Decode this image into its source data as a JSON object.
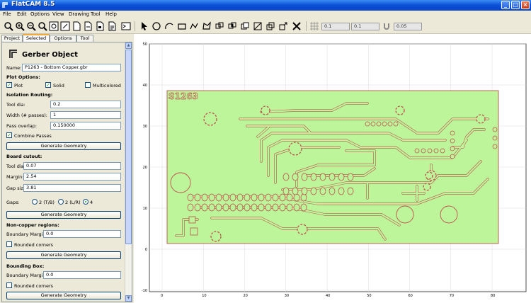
{
  "window": {
    "title": "FlatCAM 8.5",
    "controls": [
      "_",
      "□",
      "×"
    ]
  },
  "menubar": [
    "File",
    "Edit",
    "Options",
    "View",
    "Drawing",
    "Tool",
    "Help"
  ],
  "toolbar": {
    "icons": [
      "zoom-fit-icon",
      "zoom-in-icon",
      "zoom-out-icon",
      "redraw-icon",
      "clear-plot-icon",
      "new-icon",
      "open-gerber-icon",
      "open-excellon-icon",
      "open-gcode-icon",
      "shell-icon",
      "select-icon",
      "circle-icon",
      "arc-icon",
      "rectangle-icon",
      "path-icon",
      "polygon-icon",
      "union-icon",
      "intersection-icon",
      "subtract-icon",
      "cut-path-icon",
      "copy-icon",
      "move-icon",
      "delete-icon"
    ],
    "field1": "0.1",
    "field2": "0.1",
    "field3": "0.05"
  },
  "tabs": [
    {
      "label": "Project",
      "active": false
    },
    {
      "label": "Selected",
      "active": true
    },
    {
      "label": "Options",
      "active": false
    },
    {
      "label": "Tool",
      "active": false
    }
  ],
  "panel": {
    "title": "Gerber Object",
    "name_label": "Name:",
    "name_value": "P1263 - Bottom Copper.gbr",
    "plot_options": "Plot Options:",
    "plot": "Plot",
    "solid": "Solid",
    "multicolored": "Multicolored",
    "isolation": "Isolation Routing:",
    "tool_dia": "Tool dia:",
    "tool_dia_value": "0.2",
    "width": "Width (# passes):",
    "width_value": "1",
    "overlap": "Pass overlap:",
    "overlap_value": "0.150000",
    "combine": "Combine Passes",
    "gen_geom": "Generate Geometry",
    "cutout": "Board cutout:",
    "cut_tool_dia": "Tool dia:",
    "cut_tool_dia_value": "0.07",
    "margin": "Margin:",
    "margin_value": "2.54",
    "gap_size": "Gap size:",
    "gap_size_value": "3.81",
    "gaps": "Gaps:",
    "gap_opt1": "2 (T/B)",
    "gap_opt2": "2 (L/R)",
    "gap_opt3": "4",
    "gen_geom2": "Generate Geometry",
    "noncopper": "Non-copper regions:",
    "nc_margin": "Boundary Margin:",
    "nc_margin_value": "0.0",
    "nc_rounded": "Rounded corners",
    "gen_geom3": "Generate Geometry",
    "bbox": "Bounding Box:",
    "bb_margin": "Boundary Margin:",
    "bb_margin_value": "0.0",
    "bb_rounded": "Rounded corners",
    "gen_geom4": "Generate Geometry"
  },
  "plot": {
    "x_ticks": [
      "0",
      "10",
      "20",
      "30",
      "40",
      "50",
      "60",
      "70",
      "80"
    ],
    "y_ticks": [
      "50",
      "40",
      "30",
      "20",
      "10",
      "0",
      "-10"
    ],
    "board_label": "S1263",
    "colors": {
      "copper": "#bdf59a",
      "outline": "#c0504d",
      "board": "#d4f7b0"
    }
  }
}
